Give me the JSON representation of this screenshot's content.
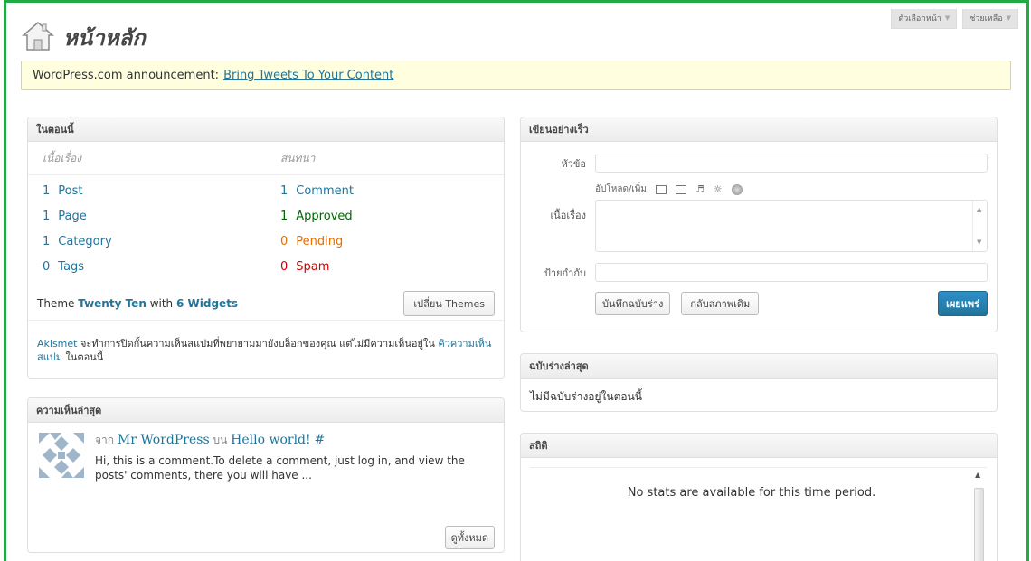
{
  "screen_options": {
    "options_label": "ตัวเลือกหน้า",
    "help_label": "ช่วยเหลือ"
  },
  "header": {
    "title": "หน้าหลัก",
    "icon": "home-icon"
  },
  "notice": {
    "prefix": "WordPress.com announcement:",
    "link": "Bring Tweets To Your Content"
  },
  "right_now": {
    "title": "ในตอนนี้",
    "content_head": "เนื้อเรื่อง",
    "discussion_head": "สนทนา",
    "content": [
      {
        "num": "1",
        "label": "Post"
      },
      {
        "num": "1",
        "label": "Page"
      },
      {
        "num": "1",
        "label": "Category"
      },
      {
        "num": "0",
        "label": "Tags"
      }
    ],
    "discussion": [
      {
        "num": "1",
        "label": "Comment"
      },
      {
        "num": "1",
        "label": "Approved"
      },
      {
        "num": "0",
        "label": "Pending"
      },
      {
        "num": "0",
        "label": "Spam"
      }
    ],
    "theme_prefix": "Theme",
    "theme_name": "Twenty Ten",
    "theme_with": "with",
    "widgets": "6 Widgets",
    "change_theme_button": "เปลี่ยน Themes",
    "akismet_link": "Akismet",
    "akismet_text": "จะทำการปิดกั้นความเห็นสแปมที่พยายามมายังบล็อกของคุณ แต่ไม่มีความเห็นอยู่ใน",
    "spam_queue_link": "คิวความเห็นสแปม",
    "akismet_suffix": "ในตอนนี้"
  },
  "recent_comments": {
    "title": "ความเห็นล่าสุด",
    "from_label": "จาก",
    "author": "Mr WordPress",
    "on_label": "บน",
    "post": "Hello world!",
    "hash": "#",
    "excerpt": "Hi, this is a comment.To delete a comment, just log in, and view the posts' comments, there you will have ...",
    "view_all_button": "ดูทั้งหมด"
  },
  "quick_press": {
    "title": "เขียนอย่างเร็ว",
    "title_label": "หัวข้อ",
    "upload_label": "อัปโหลด/เพิ่ม",
    "content_label": "เนื้อเรื่อง",
    "tags_label": "ป้ายกำกับ",
    "save_draft_button": "บันทึกฉบับร่าง",
    "reset_button": "กลับสภาพเดิม",
    "publish_button": "เผยแพร่"
  },
  "recent_drafts": {
    "title": "ฉบับร่างล่าสุด",
    "empty_text": "ไม่มีฉบับร่างอยู่ในตอนนี้"
  },
  "stats": {
    "title": "สถิติ",
    "message": "No stats are available for this time period."
  },
  "colors": {
    "frame": "#22aa44",
    "link": "#21759b",
    "approved": "#006505",
    "pending": "#e66f00",
    "spam": "#cc0000",
    "notice_bg": "#ffffe0"
  }
}
